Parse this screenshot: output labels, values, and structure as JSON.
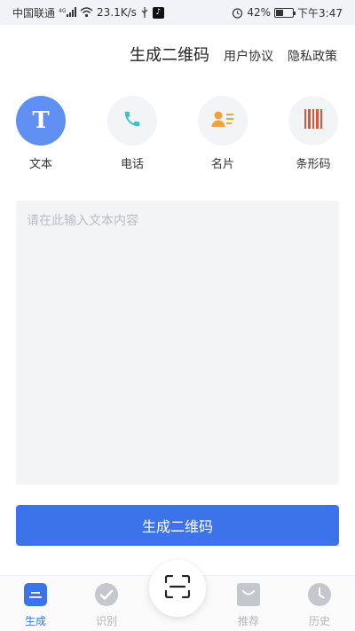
{
  "status_bar": {
    "carrier": "中国联通",
    "network": "4G",
    "speed": "23.1K/s",
    "battery": "42%",
    "battery_fraction": 0.42,
    "time": "下午3:47"
  },
  "header": {
    "title": "生成二维码",
    "user_agreement": "用户协议",
    "privacy_policy": "隐私政策"
  },
  "types": [
    {
      "label": "文本",
      "icon": "text-T-icon",
      "active": true
    },
    {
      "label": "电话",
      "icon": "phone-icon",
      "active": false
    },
    {
      "label": "名片",
      "icon": "business-card-icon",
      "active": false
    },
    {
      "label": "条形码",
      "icon": "barcode-icon",
      "active": false
    }
  ],
  "input": {
    "placeholder": "请在此输入文本内容",
    "value": ""
  },
  "generate_button": "生成二维码",
  "bottom_nav": [
    {
      "label": "生成",
      "icon": "generate-icon",
      "active": true
    },
    {
      "label": "识别",
      "icon": "check-icon",
      "active": false
    },
    {
      "label": "",
      "icon": "scan-icon",
      "active": false
    },
    {
      "label": "推荐",
      "icon": "recommend-icon",
      "active": false
    },
    {
      "label": "历史",
      "icon": "clock-icon",
      "active": false
    }
  ],
  "colors": {
    "accent": "#3c73ea",
    "active_type": "#5f8ff1",
    "inactive": "#b0b4bb",
    "phone": "#3cc4c4",
    "card": "#f3a13a",
    "barcode": "#e2543a"
  }
}
